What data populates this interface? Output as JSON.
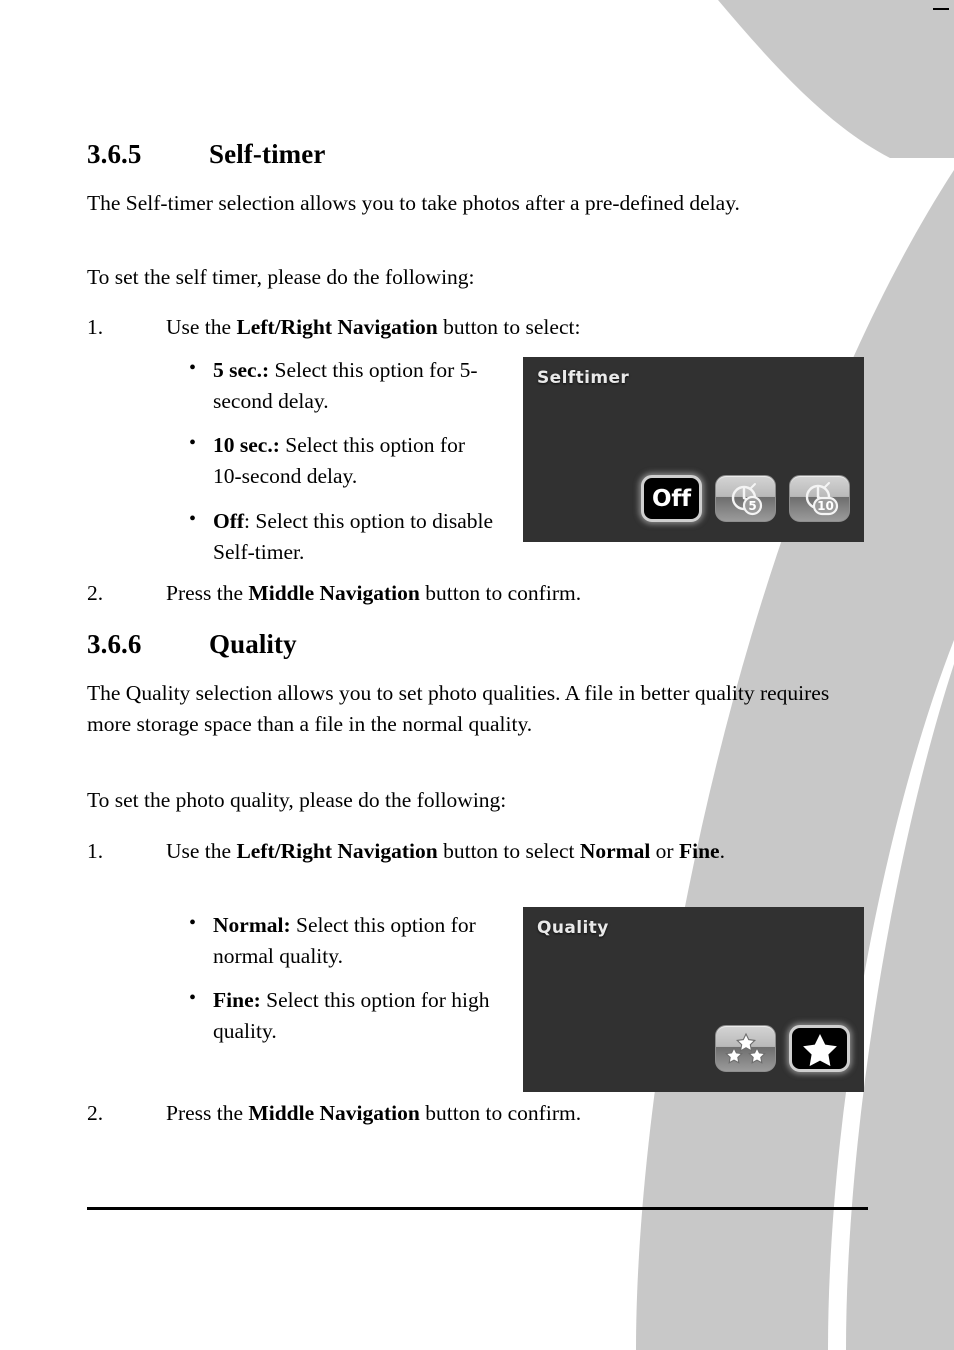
{
  "page": {
    "background_color": "#ffffff",
    "swoosh_color": "#c8c8c8",
    "text_color": "#000000"
  },
  "sections": [
    {
      "number": "3.6.5",
      "title": "Self-timer",
      "intro": "The Self-timer selection allows you to take photos after a pre-defined delay.",
      "lead_in": "To set the self timer, please do the following:",
      "steps": [
        {
          "marker": "1.",
          "text_before_bold": "Use the ",
          "bold": "Left/Right Navigation",
          "text_after_bold": " button to select:"
        },
        {
          "marker": "2.",
          "text_before_bold": "Press the ",
          "bold": "Middle Navigation",
          "text_after_bold": " button to confirm."
        }
      ],
      "bullets": [
        {
          "label": "5 sec.:",
          "text": " Select this option for 5-second delay."
        },
        {
          "label": "10 sec.:",
          "text": " Select this option for 10-second delay."
        },
        {
          "label": "Off",
          "text": ": Select this option to disable Self-timer."
        }
      ]
    },
    {
      "number": "3.6.6",
      "title": "Quality",
      "intro": "The Quality selection allows you to set photo qualities. A file in better quality requires more storage space than a file in the normal quality.",
      "lead_in": "To set the photo quality, please do the following:",
      "steps": [
        {
          "marker": "1.",
          "text_before_bold": "Use the ",
          "bold": "Left/Right Navigation",
          "text_mid": " button to select ",
          "bold2": "Normal",
          "text_mid2": " or ",
          "bold3": "Fine",
          "text_after_bold": "."
        },
        {
          "marker": "2.",
          "text_before_bold": "Press the ",
          "bold": "Middle Navigation",
          "text_after_bold": " button to confirm."
        }
      ],
      "bullets": [
        {
          "label": "Normal:",
          "text": " Select this option for normal quality."
        },
        {
          "label": "Fine:",
          "text": " Select this option for high quality."
        }
      ]
    }
  ],
  "camera_screens": [
    {
      "id": "selftimer-screen",
      "title": "Selftimer",
      "background_color": "#313131",
      "options": [
        {
          "label": "Off",
          "icon": "off-text-icon",
          "selected": true
        },
        {
          "label": "5 sec.",
          "icon": "timer-5-icon",
          "selected": false
        },
        {
          "label": "10 sec.",
          "icon": "timer-10-icon",
          "selected": false
        }
      ]
    },
    {
      "id": "quality-screen",
      "title": "Quality",
      "background_color": "#313131",
      "options": [
        {
          "label": "Normal",
          "icon": "three-stars-icon",
          "selected": false
        },
        {
          "label": "Fine",
          "icon": "single-star-icon",
          "selected": true
        }
      ]
    }
  ]
}
